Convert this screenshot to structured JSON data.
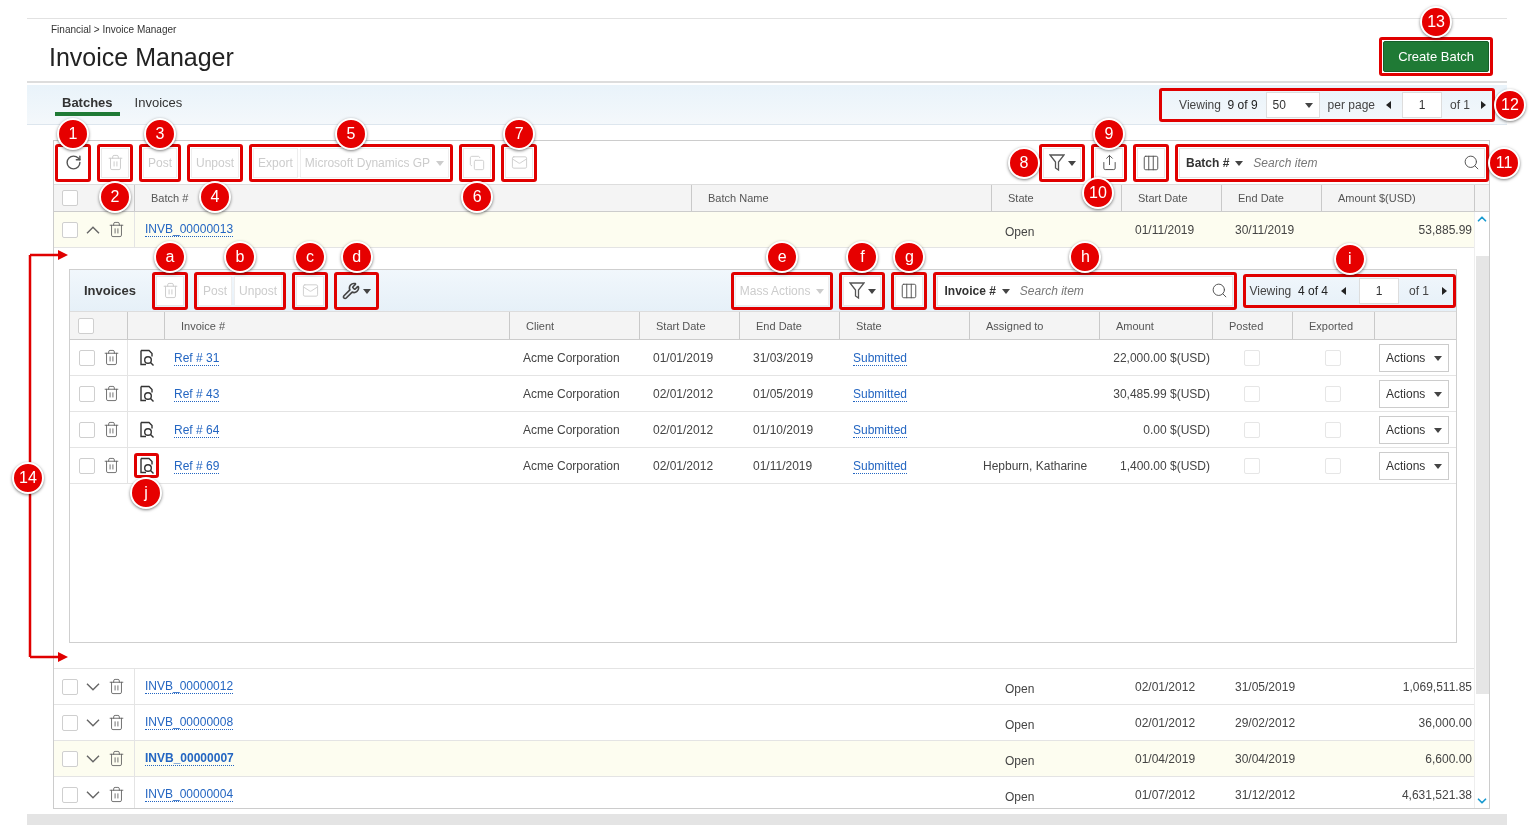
{
  "breadcrumb": "Financial > Invoice Manager",
  "title": "Invoice Manager",
  "create_button": {
    "label": "Create Batch",
    "callout": {
      "label": "13"
    }
  },
  "tabs": [
    {
      "label": "Batches",
      "selected": true
    },
    {
      "label": "Invoices",
      "selected": false
    }
  ],
  "pagination": {
    "viewing_label": "Viewing",
    "viewing": "9 of 9",
    "per_page": "50",
    "per_page_label": "per page",
    "page": "1",
    "of": "of 1",
    "callout": {
      "label": "12"
    }
  },
  "toolbar": {
    "left": [
      {
        "kind": "refresh",
        "disabled": false,
        "callout": {
          "label": "1"
        }
      },
      {
        "kind": "trash",
        "disabled": true,
        "callout": {
          "label": "2"
        }
      },
      {
        "kind": "text",
        "label": "Post",
        "disabled": true,
        "callout": {
          "label": "3"
        }
      },
      {
        "kind": "text",
        "label": "Unpost",
        "disabled": true,
        "callout": {
          "label": "4"
        }
      },
      {
        "kind": "group",
        "callout": {
          "label": "5"
        },
        "items": [
          {
            "kind": "text",
            "label": "Export",
            "disabled": true
          },
          {
            "kind": "dropdown",
            "label": "Microsoft Dynamics GP",
            "disabled": true
          }
        ]
      },
      {
        "kind": "copy",
        "disabled": true,
        "callout": {
          "label": "6"
        }
      },
      {
        "kind": "mail",
        "disabled": true,
        "callout": {
          "label": "7"
        }
      }
    ],
    "right": [
      {
        "kind": "filter",
        "disabled": false,
        "callout": {
          "label": "8"
        }
      },
      {
        "kind": "share",
        "disabled": false,
        "callout": {
          "label": "9"
        }
      },
      {
        "kind": "columns",
        "disabled": false,
        "callout": {
          "label": "10"
        }
      },
      {
        "kind": "search",
        "field": "Batch #",
        "placeholder": "Search item",
        "callout": {
          "label": "11"
        }
      }
    ]
  },
  "table": {
    "select_all": {
      "checked": false
    },
    "columns": [
      "Batch #",
      "Batch Name",
      "State",
      "Start Date",
      "End Date",
      "Amount $(USD)"
    ],
    "rows": [
      {
        "batch": "INVB_00000013",
        "state": "Open",
        "start": "01/11/2019",
        "end": "30/11/2019",
        "amount": "53,885.99",
        "checked": false,
        "expanded": true,
        "hover": false,
        "detail": {
          "title": "Invoices",
          "toolbar": {
            "left": [
              {
                "kind": "trash",
                "disabled": true,
                "callout": {
                  "label": "a"
                }
              },
              {
                "kind": "group",
                "callout": {
                  "label": "b"
                },
                "items": [
                  {
                    "kind": "text",
                    "label": "Post",
                    "disabled": true
                  },
                  {
                    "kind": "text",
                    "label": "Unpost",
                    "disabled": true
                  }
                ]
              },
              {
                "kind": "mail",
                "disabled": true,
                "callout": {
                  "label": "c"
                }
              },
              {
                "kind": "tools",
                "callout": {
                  "label": "d"
                }
              }
            ],
            "right": [
              {
                "kind": "dropdown",
                "label": "Mass Actions",
                "disabled": true,
                "callout": {
                  "label": "e"
                }
              },
              {
                "kind": "filter",
                "disabled": false,
                "callout": {
                  "label": "f"
                }
              },
              {
                "kind": "columns",
                "disabled": false,
                "callout": {
                  "label": "g"
                }
              },
              {
                "kind": "search",
                "field": "Invoice #",
                "placeholder": "Search item",
                "callout": {
                  "label": "h"
                }
              },
              {
                "kind": "pager",
                "viewing_label": "Viewing",
                "viewing": "4 of 4",
                "page": "1",
                "of": "of 1",
                "callout": {
                  "label": "i"
                }
              }
            ]
          },
          "select_all": {
            "checked": false
          },
          "columns": [
            "Invoice #",
            "Client",
            "Start Date",
            "End Date",
            "State",
            "Assigned to",
            "Amount",
            "Posted",
            "Exported"
          ],
          "rows": [
            {
              "ref": "Ref # 31",
              "client": "Acme Corporation",
              "start": "01/01/2019",
              "end": "31/03/2019",
              "state": "Submitted",
              "amount": "22,000.00 $(USD)",
              "checked": false,
              "posted": false,
              "exported": false,
              "action": "Actions"
            },
            {
              "ref": "Ref # 43",
              "client": "Acme Corporation",
              "start": "02/01/2012",
              "end": "01/05/2019",
              "state": "Submitted",
              "amount": "30,485.99 $(USD)",
              "checked": false,
              "posted": false,
              "exported": false,
              "action": "Actions"
            },
            {
              "ref": "Ref # 64",
              "client": "Acme Corporation",
              "start": "02/01/2012",
              "end": "01/10/2019",
              "state": "Submitted",
              "amount": "0.00 $(USD)",
              "checked": false,
              "posted": false,
              "exported": false,
              "action": "Actions"
            },
            {
              "ref": "Ref # 69",
              "client": "Acme Corporation",
              "start": "02/01/2012",
              "end": "01/11/2019",
              "state": "Submitted",
              "assigned": "Hepburn, Katharine",
              "amount": "1,400.00 $(USD)",
              "checked": false,
              "posted": false,
              "exported": false,
              "action": "Actions",
              "view_callout": {
                "label": "j"
              }
            }
          ]
        }
      },
      {
        "batch": "INVB_00000012",
        "state": "Open",
        "start": "02/01/2012",
        "end": "31/05/2019",
        "amount": "1,069,511.85",
        "checked": false,
        "expanded": false,
        "hover": false
      },
      {
        "batch": "INVB_00000008",
        "state": "Open",
        "start": "02/01/2012",
        "end": "29/02/2012",
        "amount": "36,000.00",
        "checked": false,
        "expanded": false,
        "hover": false
      },
      {
        "batch": "INVB_00000007",
        "state": "Open",
        "start": "01/04/2019",
        "end": "30/04/2019",
        "amount": "6,600.00",
        "checked": false,
        "expanded": false,
        "hover": true
      },
      {
        "batch": "INVB_00000004",
        "state": "Open",
        "start": "01/07/2012",
        "end": "31/12/2012",
        "amount": "4,631,521.38",
        "checked": false,
        "expanded": false,
        "hover": false
      }
    ]
  },
  "bracket_callout": {
    "label": "14"
  }
}
